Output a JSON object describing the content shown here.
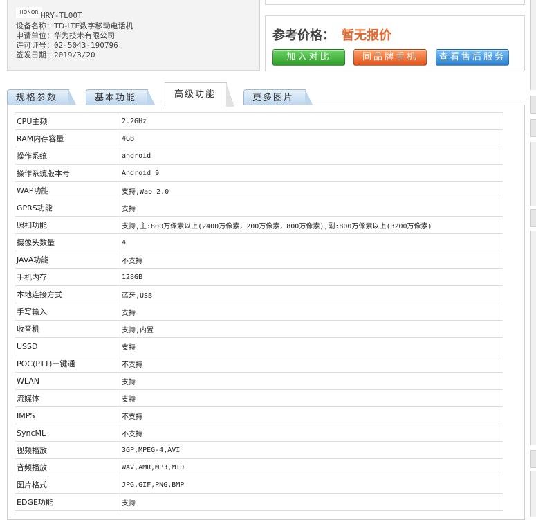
{
  "device": {
    "logo_text": "HONOR",
    "model": "HRY-TL00T",
    "rows": [
      {
        "label": "设备名称：",
        "value": "TD-LTE数字移动电话机"
      },
      {
        "label": "申请单位：",
        "value": "华为技术有限公司"
      },
      {
        "label": "许可证号：",
        "value": "02-5043-190796"
      },
      {
        "label": "签发日期：",
        "value": "2019/3/20"
      }
    ]
  },
  "price": {
    "label": "参考价格：",
    "value": "暂无报价",
    "buttons": {
      "compare": "加入对比",
      "same_brand": "同品牌手机",
      "after_sales": "查看售后服务"
    }
  },
  "tabs": [
    {
      "label": "规格参数",
      "active": false
    },
    {
      "label": "基本功能",
      "active": false
    },
    {
      "label": "高级功能",
      "active": true
    },
    {
      "label": "更多图片",
      "active": false
    }
  ],
  "specs": [
    [
      "CPU主频",
      "2.2GHz"
    ],
    [
      "RAM内存容量",
      "4GB"
    ],
    [
      "操作系统",
      "android"
    ],
    [
      "操作系统版本号",
      "Android 9"
    ],
    [
      "WAP功能",
      "支持,Wap 2.0"
    ],
    [
      "GPRS功能",
      "支持"
    ],
    [
      "照相功能",
      "支持,主:800万像素以上(2400万像素，200万像素，800万像素),副:800万像素以上(3200万像素)"
    ],
    [
      "摄像头数量",
      "4"
    ],
    [
      "JAVA功能",
      "不支持"
    ],
    [
      "手机内存",
      "128GB"
    ],
    [
      "本地连接方式",
      "蓝牙,USB"
    ],
    [
      "手写输入",
      "支持"
    ],
    [
      "收音机",
      "支持,内置"
    ],
    [
      "USSD",
      "支持"
    ],
    [
      "POC(PTT)一键通",
      "不支持"
    ],
    [
      "WLAN",
      "支持"
    ],
    [
      "流媒体",
      "支持"
    ],
    [
      "IMPS",
      "不支持"
    ],
    [
      "SyncML",
      "不支持"
    ],
    [
      "视频播放",
      "3GP,MPEG-4,AVI"
    ],
    [
      "音频播放",
      "WAV,AMR,MP3,MID"
    ],
    [
      "图片格式",
      "JPG,GIF,PNG,BMP"
    ],
    [
      "EDGE功能",
      "支持"
    ]
  ]
}
